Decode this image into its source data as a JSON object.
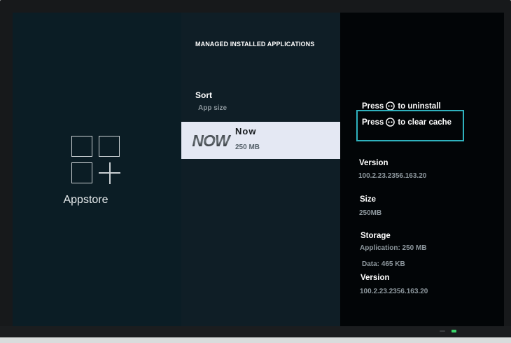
{
  "left_panel": {
    "app_label": "Appstore",
    "icon": "appstore-grid-icon"
  },
  "middle_panel": {
    "title": "MANAGED INSTALLED APPLICATIONS",
    "sort": {
      "label": "Sort",
      "value": "App size"
    },
    "apps": [
      {
        "logo_text": "NOW",
        "name": "Now",
        "size": "250 MB",
        "selected": true
      }
    ]
  },
  "right_panel": {
    "actions": [
      {
        "prefix": "Press",
        "icon": "remote-button-icon",
        "suffix": "to uninstall"
      },
      {
        "prefix": "Press",
        "icon": "remote-button-icon",
        "suffix": "to clear cache",
        "focused": true
      }
    ],
    "details": {
      "version_label": "Version",
      "version_value": "100.2.23.2356.163.20",
      "size_label": "Size",
      "size_value": "250MB",
      "storage_label": "Storage",
      "storage_application": "Application: 250 MB",
      "storage_data": "Data: 465 KB",
      "version2_label": "Version",
      "version2_value": "100.2.23.2356.163.20"
    }
  },
  "colors": {
    "focus_border": "#2fb2be",
    "selected_item_bg": "#e4e8f3",
    "power_led": "#39d36a"
  }
}
